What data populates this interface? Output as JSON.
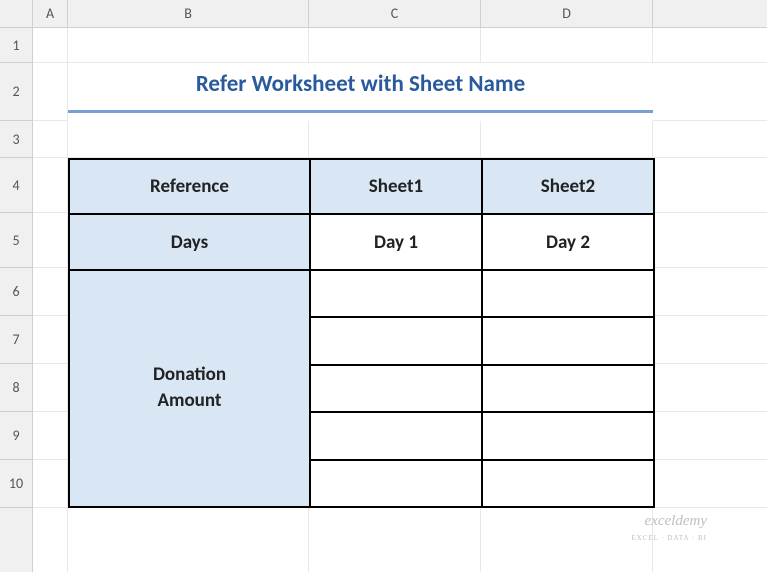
{
  "columns": [
    "A",
    "B",
    "C",
    "D"
  ],
  "rows": [
    "1",
    "2",
    "3",
    "4",
    "5",
    "6",
    "7",
    "8",
    "9",
    "10"
  ],
  "title": "Refer Worksheet with Sheet Name",
  "table": {
    "headers": {
      "reference_label": "Reference",
      "sheet1": "Sheet1",
      "sheet2": "Sheet2"
    },
    "days_row": {
      "label": "Days",
      "day1": "Day 1",
      "day2": "Day 2"
    },
    "merged_label_line1": "Donation",
    "merged_label_line2": "Amount",
    "data_rows": [
      {
        "c": "",
        "d": ""
      },
      {
        "c": "",
        "d": ""
      },
      {
        "c": "",
        "d": ""
      },
      {
        "c": "",
        "d": ""
      },
      {
        "c": "",
        "d": ""
      }
    ]
  },
  "watermark": {
    "main": "exceldemy",
    "sub": "EXCEL · DATA · BI"
  },
  "chart_data": {
    "type": "table",
    "title": "Refer Worksheet with Sheet Name",
    "columns": [
      "Reference",
      "Sheet1",
      "Sheet2"
    ],
    "rows": [
      [
        "Days",
        "Day 1",
        "Day 2"
      ],
      [
        "Donation Amount",
        "",
        ""
      ],
      [
        "Donation Amount",
        "",
        ""
      ],
      [
        "Donation Amount",
        "",
        ""
      ],
      [
        "Donation Amount",
        "",
        ""
      ],
      [
        "Donation Amount",
        "",
        ""
      ]
    ]
  }
}
